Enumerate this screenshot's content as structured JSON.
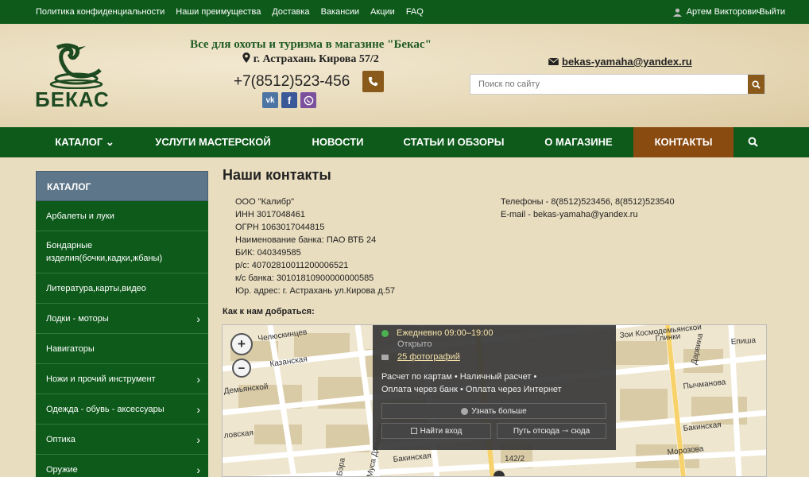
{
  "topbar": {
    "links": [
      "Политика конфиденциальности",
      "Наши преимущества",
      "Доставка",
      "Вакансии",
      "Акции",
      "FAQ"
    ],
    "user_name": "Артем Викторович",
    "logout": "Выйти"
  },
  "header": {
    "logo_text": "БЕКАС",
    "tagline": "Все для охоты и туризма в магазине \"Бекас\"",
    "address": "г. Астрахань Кирова 57/2",
    "phone": "+7(8512)523-456",
    "email": "bekas-yamaha@yandex.ru",
    "search_placeholder": "Поиск по сайту",
    "social": [
      "vk",
      "f"
    ]
  },
  "nav": {
    "items": [
      "КАТАЛОГ ⌄",
      "УСЛУГИ МАСТЕРСКОЙ",
      "НОВОСТИ",
      "СТАТЬИ И ОБЗОРЫ",
      "О МАГАЗИНЕ",
      "КОНТАКТЫ"
    ],
    "active_index": 5
  },
  "sidebar": {
    "title": "КАТАЛОГ",
    "items": [
      {
        "label": "Арбалеты и луки",
        "has_sub": false
      },
      {
        "label": "Бондарные изделия(бочки,кадки,жбаны)",
        "has_sub": false
      },
      {
        "label": "Литература,карты,видео",
        "has_sub": false
      },
      {
        "label": "Лодки - моторы",
        "has_sub": true
      },
      {
        "label": "Навигаторы",
        "has_sub": false
      },
      {
        "label": "Ножи и прочий инструмент",
        "has_sub": true
      },
      {
        "label": "Одежда - обувь - аксессуары",
        "has_sub": true
      },
      {
        "label": "Оптика",
        "has_sub": true
      },
      {
        "label": "Оружие",
        "has_sub": true
      }
    ]
  },
  "contacts": {
    "title": "Наши контакты",
    "company": [
      "ООО \"Калибр\"",
      "ИНН 3017048461",
      "ОГРН 1063017044815",
      "Наименование банка: ПАО ВТБ 24",
      "БИК: 040349585",
      "р/с: 40702810011200006521",
      "к/с банка: 30101810900000000585",
      "Юр. адрес: г. Астрахань ул.Кирова д.57"
    ],
    "phones": "Телефоны - 8(8512)523456, 8(8512)523540",
    "email": "E-mail - bekas-yamaha@yandex.ru",
    "howto": "Как к нам добраться:"
  },
  "map": {
    "streets": [
      "Челюскинцев",
      "Казанская",
      "Бэра",
      "Бакинская",
      "Муса Джалиля",
      "Морозова",
      "Пычманова",
      "Бакинская",
      "Дарвина",
      "Епиша",
      "Зои Космодемьянской",
      "Глинки",
      "142/2",
      "Демьянской",
      "ловская"
    ],
    "popup": {
      "hours": "Ежедневно 09:00–19:00",
      "status": "Открыто",
      "photos": "25 фотографий",
      "payment1": "Расчет по картам • Наличный расчет •",
      "payment2": "Оплата через банк • Оплата через Интернет",
      "more": "Узнать больше",
      "entrance": "Найти вход",
      "route": "Путь отсюда",
      "route_to": "сюда"
    }
  },
  "colors": {
    "green": "#0d5a1b",
    "brown": "#8a4b10",
    "sidebar_head": "#5e7689"
  }
}
